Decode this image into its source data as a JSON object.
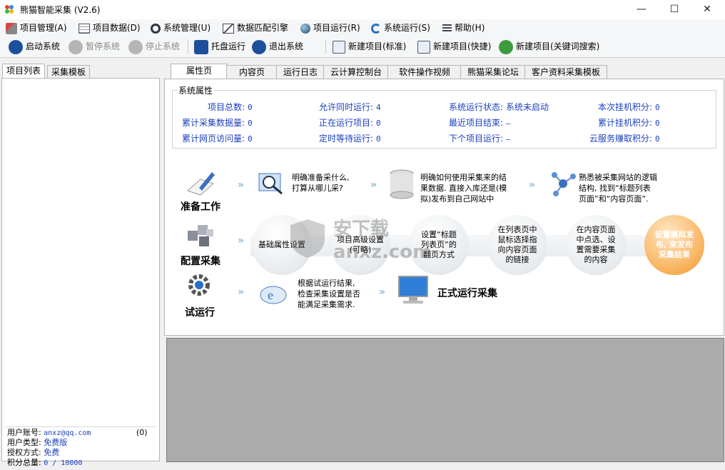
{
  "window": {
    "title": "熊猫智能采集  (V2.6)",
    "minimize": "—",
    "maximize": "☐",
    "close": "✕"
  },
  "menu": {
    "items": [
      "项目管理(A)",
      "项目数据(D)",
      "系统管理(U)",
      "数据匹配引擎",
      "项目运行(R)",
      "系统运行(S)",
      "帮助(H)"
    ]
  },
  "toolbar": {
    "start": "启动系统",
    "pause": "暂停系统",
    "stop": "停止系统",
    "tray": "托盘运行",
    "exit": "退出系统",
    "new_std": "新建项目(标准)",
    "new_quick": "新建项目(快捷)",
    "new_kw": "新建项目(关键词搜索)"
  },
  "left": {
    "tabs": [
      "项目列表",
      "采集模板"
    ],
    "user": {
      "account_label": "用户账号:",
      "account": "anxz@qq.com",
      "count": "(0)",
      "type_label": "用户类型:",
      "type": "免费版",
      "auth_label": "授权方式:",
      "auth": "免费",
      "points_label": "积分总量:",
      "points": "0 / 10000"
    }
  },
  "tabs": [
    "属性页",
    "内容页",
    "运行日志",
    "云计算控制台",
    "软件操作视频",
    "熊猫采集论坛",
    "客户资料采集模板"
  ],
  "props": {
    "title": "系统属性",
    "stats": [
      {
        "label": "项目总数:",
        "value": "0"
      },
      {
        "label": "允许同时运行:",
        "value": "4"
      },
      {
        "label": "系统运行状态:",
        "value": "系统未启动"
      },
      {
        "label": "本次挂机积分:",
        "value": "0"
      },
      {
        "label": "累计采集数据量:",
        "value": "0"
      },
      {
        "label": "正在运行项目:",
        "value": "0"
      },
      {
        "label": "最近项目结束:",
        "value": "—"
      },
      {
        "label": "累计挂机积分:",
        "value": "0"
      },
      {
        "label": "累计网页访问量:",
        "value": "0"
      },
      {
        "label": "定时等待运行:",
        "value": "0"
      },
      {
        "label": "下个项目运行:",
        "value": "—"
      },
      {
        "label": "云服务赚取积分:",
        "value": "0"
      }
    ]
  },
  "flow": {
    "row1_label": "准备工作",
    "row1_t1": "明确准备采什么,\n打算从哪儿采?",
    "row1_t2": "明确如何使用采集来的结\n果数据. 直接入库还是(模\n拟)发布到自己网站中",
    "row1_t3": "熟悉被采集网站的逻辑\n结构, 找到“标题列表\n页面”和“内容页面”.",
    "row2_label": "配置采集",
    "steps": [
      "基础属性设置",
      "项目高级设置\n(可略)",
      "设置“标题\n列表页”的\n翻页方式",
      "在列表页中\n鼠标选择指\n向内容页面\n的链接",
      "在内容页面\n中点选、设\n置需要采集\n的内容",
      "设置模拟发\n布, 来发布\n采集结果"
    ],
    "row3_label": "试运行",
    "row3_t1": "根据试运行结果,\n检查采集设置是否\n能满足采集需求.",
    "row3_t2": "正式运行采集",
    "watermark": "安下载\nanxz.com"
  }
}
